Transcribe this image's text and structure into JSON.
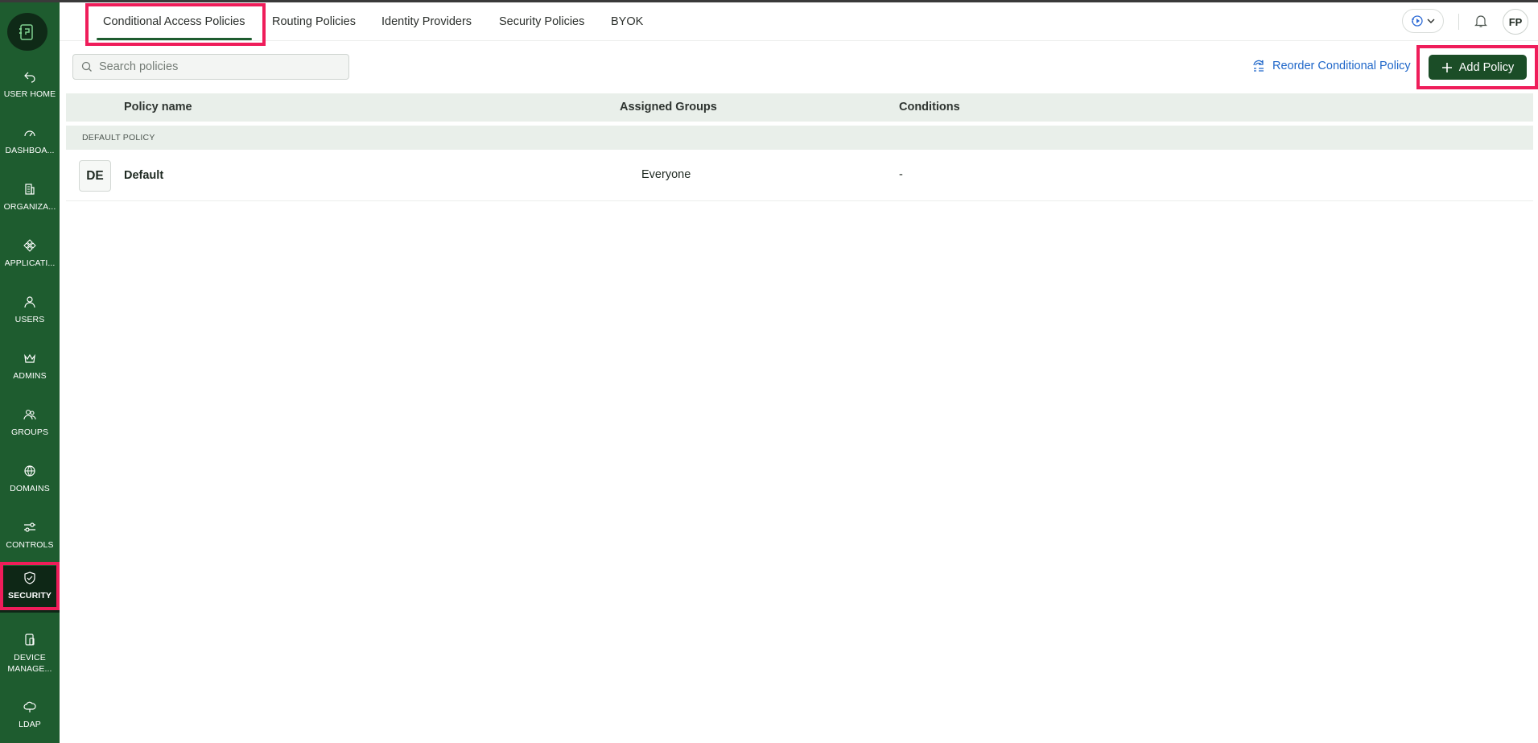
{
  "sidebar": {
    "items": [
      {
        "label": "USER HOME"
      },
      {
        "label": "DASHBOA..."
      },
      {
        "label": "ORGANIZA..."
      },
      {
        "label": "APPLICATI..."
      },
      {
        "label": "USERS"
      },
      {
        "label": "ADMINS"
      },
      {
        "label": "GROUPS"
      },
      {
        "label": "DOMAINS"
      },
      {
        "label": "CONTROLS"
      },
      {
        "label": "SECURITY"
      },
      {
        "label": "DEVICE MANAGE..."
      },
      {
        "label": "LDAP"
      }
    ],
    "active": "SECURITY"
  },
  "tabs": [
    {
      "label": "Conditional Access Policies"
    },
    {
      "label": "Routing Policies"
    },
    {
      "label": "Identity Providers"
    },
    {
      "label": "Security Policies"
    },
    {
      "label": "BYOK"
    }
  ],
  "header": {
    "avatar_initials": "FP"
  },
  "toolbar": {
    "search_placeholder": "Search policies",
    "reorder_label": "Reorder Conditional Policy",
    "add_label": "Add Policy"
  },
  "table": {
    "columns": [
      "Policy name",
      "Assigned Groups",
      "Conditions"
    ],
    "group_label": "DEFAULT POLICY",
    "rows": [
      {
        "initials": "DE",
        "name": "Default",
        "groups": "Everyone",
        "conditions": "-"
      }
    ]
  },
  "colors": {
    "sidebar": "#1e5c2f",
    "sidebar_active": "#0e2716",
    "primary_button": "#1b4d27",
    "link": "#1e66c9",
    "highlight": "#ef1d5a"
  }
}
